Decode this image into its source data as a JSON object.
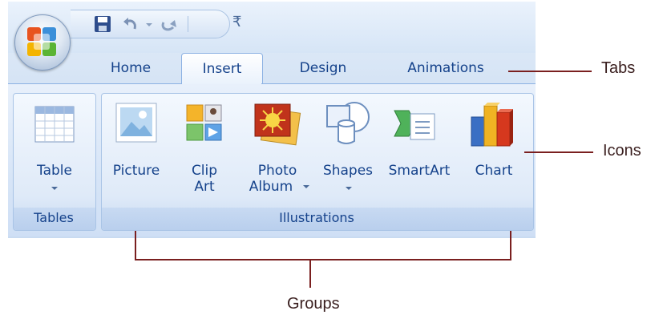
{
  "qat": {
    "customize_glyph": "₹"
  },
  "tabs": [
    "Home",
    "Insert",
    "Design",
    "Animations"
  ],
  "active_tab": "Insert",
  "groups": {
    "tables": {
      "label": "Tables",
      "buttons": {
        "table": "Table"
      }
    },
    "illustrations": {
      "label": "Illustrations",
      "buttons": {
        "picture": "Picture",
        "clip_art_1": "Clip",
        "clip_art_2": "Art",
        "photo_album_1": "Photo",
        "photo_album_2": "Album",
        "shapes": "Shapes",
        "smartart": "SmartArt",
        "chart": "Chart"
      }
    }
  },
  "annotations": {
    "tabs": "Tabs",
    "icons": "Icons",
    "groups": "Groups"
  },
  "colors": {
    "ribbon_text": "#15428b",
    "annotation_line": "#7a1f1f"
  }
}
